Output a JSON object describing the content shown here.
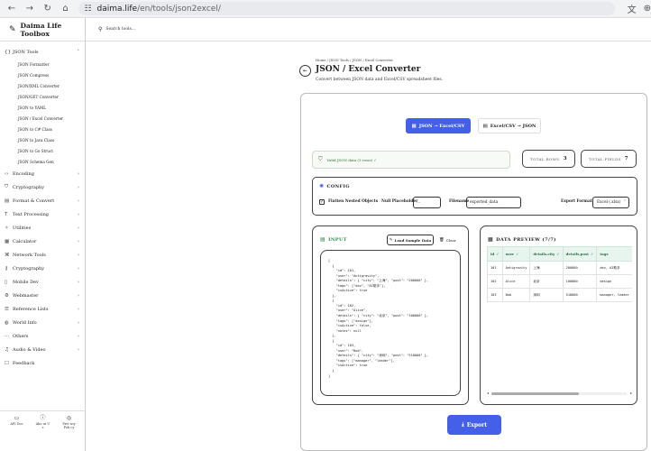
{
  "browser": {
    "url_host": "daima.life",
    "url_path": "/en/tools/json2excel/"
  },
  "sidebar": {
    "brand": "Daima Life Toolbox",
    "sections": [
      {
        "label": "JSON Tools",
        "icon": "braces-icon",
        "expanded": true,
        "items": [
          "JSON Formatter",
          "JSON Compress",
          "JSON/XML Converter",
          "JSON/GET Converter",
          "JSON to YAML",
          "JSON / Excel Converter",
          "JSON to C# Class",
          "JSON to Java Class",
          "JSON to Go Struct",
          "JSON Schema Gen"
        ]
      },
      {
        "label": "Encoding",
        "icon": "code-icon"
      },
      {
        "label": "Cryptography",
        "icon": "shield-icon"
      },
      {
        "label": "Format & Convert",
        "icon": "doc-icon"
      },
      {
        "label": "Text Processing",
        "icon": "text-icon"
      },
      {
        "label": "Utilities",
        "icon": "tool-icon"
      },
      {
        "label": "Calculator",
        "icon": "calculator-icon"
      },
      {
        "label": "Network Tools",
        "icon": "network-icon"
      },
      {
        "label": "Cryptography",
        "icon": "key-icon"
      },
      {
        "label": "Mobile Dev",
        "icon": "mobile-icon"
      },
      {
        "label": "Webmaster",
        "icon": "webmaster-icon"
      },
      {
        "label": "Reference Lists",
        "icon": "list-icon"
      },
      {
        "label": "World Info",
        "icon": "globe-icon"
      },
      {
        "label": "Others",
        "icon": "dots-icon"
      },
      {
        "label": "Audio & Video",
        "icon": "music-icon"
      },
      {
        "label": "Feedback",
        "icon": "feedback-icon"
      }
    ],
    "footer": [
      {
        "label": "API Doc",
        "icon": "api-doc-icon"
      },
      {
        "label": "Abo ut U s",
        "icon": "info-icon"
      },
      {
        "label": "Priv acy Poli cy",
        "icon": "privacy-icon"
      }
    ]
  },
  "topbar": {
    "search_placeholder": "Search tools..."
  },
  "page": {
    "breadcrumb": "Home / JSON Tools / JSON / Excel Converter",
    "title": "JSON / Excel Converter",
    "subtitle": "Convert between JSON data and Excel/CSV spreadsheet files."
  },
  "modes": {
    "json_to_excel": "JSON → Excel/CSV",
    "excel_to_json": "Excel/CSV → JSON"
  },
  "status": {
    "valid_text": "Valid JSON data (3 rows) ✓",
    "total_rows_label": "TOTAL ROWS",
    "total_rows_value": "3",
    "total_fields_label": "TOTAL FIELDS",
    "total_fields_value": "7"
  },
  "config": {
    "title": "CONFIG",
    "flatten_label": "Flatten Nested Objects",
    "null_placeholder_label": "Null Placeholder",
    "null_placeholder_value": "...",
    "filename_label": "Filename",
    "filename_value": "exported_data",
    "export_format_label": "Export Format",
    "export_format_value": "Excel (.xlsx)"
  },
  "input": {
    "title": "INPUT",
    "load_sample_label": "Load Sample Data",
    "clear_label": "Clear",
    "code": "[\n  {\n    \"id\": 101,\n    \"user\": \"Antigravity\",\n    \"details\": { \"city\": \"上海\", \"post\": \"200000\" },\n    \"tags\": [\"dev\", \"AI助手\"],\n    \"isActive\": true\n  },\n  {\n    \"id\": 102,\n    \"user\": \"Alice\",\n    \"details\": { \"city\": \"北京\", \"post\": \"100000\" },\n    \"tags\": [\"design\"],\n    \"isActive\": false,\n    \"notes\": null\n  },\n  {\n    \"id\": 103,\n    \"user\": \"Bob\",\n    \"details\": { \"city\": \"深圳\", \"post\": \"518000\" },\n    \"tags\": [\"manager\", \"leader\"],\n    \"isActive\": true\n  }\n]"
  },
  "preview": {
    "title": "DATA PREVIEW (7/7)",
    "columns": [
      "id",
      "user",
      "details.city",
      "details.post",
      "tags"
    ],
    "rows": [
      [
        "101",
        "Antigravity",
        "上海",
        "200000",
        "dev, AI助手"
      ],
      [
        "102",
        "Alice",
        "北京",
        "100000",
        "design"
      ],
      [
        "103",
        "Bob",
        "深圳",
        "518000",
        "manager, leader"
      ]
    ]
  },
  "export": {
    "label": "Export"
  }
}
